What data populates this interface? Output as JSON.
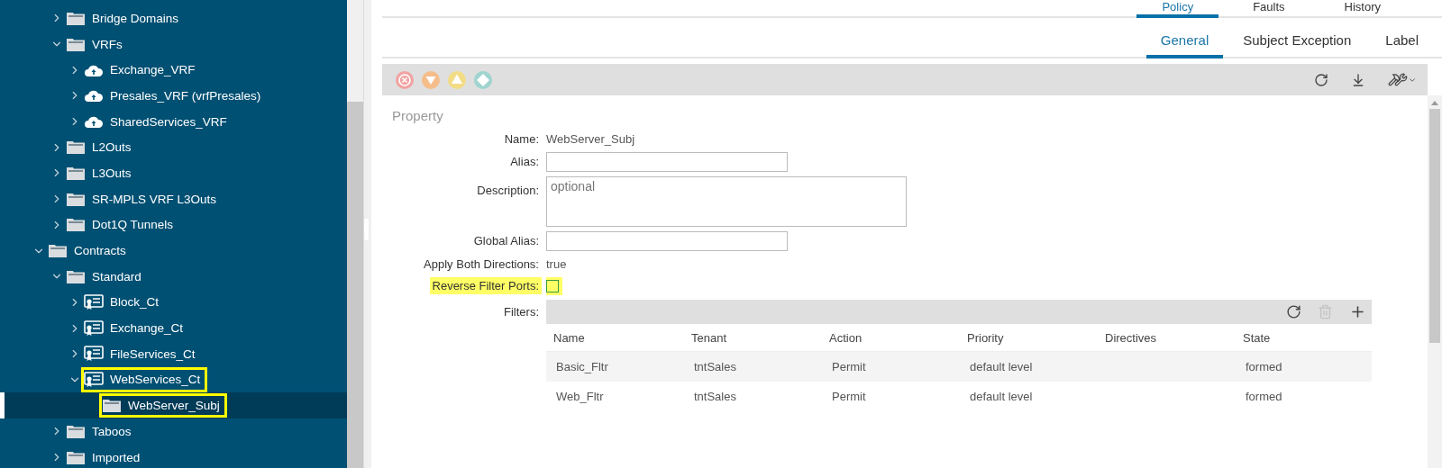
{
  "sidebar": {
    "tree": [
      {
        "children": [
          {
            "label": "Bridge Domains",
            "kind": "folder",
            "expanded": false,
            "selected": false,
            "highlighted": false
          },
          {
            "label": "VRFs",
            "kind": "folder",
            "expanded": true,
            "selected": false,
            "highlighted": false,
            "children": [
              {
                "label": "Exchange_VRF",
                "kind": "vrf",
                "expanded": false,
                "selected": false,
                "highlighted": false
              },
              {
                "label": "Presales_VRF (vrfPresales)",
                "kind": "vrf",
                "expanded": false,
                "selected": false,
                "highlighted": false
              },
              {
                "label": "SharedServices_VRF",
                "kind": "vrf",
                "expanded": false,
                "selected": false,
                "highlighted": false
              }
            ]
          },
          {
            "label": "L2Outs",
            "kind": "folder",
            "expanded": false,
            "selected": false,
            "highlighted": false
          },
          {
            "label": "L3Outs",
            "kind": "folder",
            "expanded": false,
            "selected": false,
            "highlighted": false
          },
          {
            "label": "SR-MPLS VRF L3Outs",
            "kind": "folder",
            "expanded": false,
            "selected": false,
            "highlighted": false
          },
          {
            "label": "Dot1Q Tunnels",
            "kind": "folder",
            "expanded": false,
            "selected": false,
            "highlighted": false
          }
        ]
      },
      {
        "label": "Contracts",
        "kind": "folder",
        "expanded": true,
        "selected": false,
        "highlighted": false,
        "children": [
          {
            "label": "Standard",
            "kind": "folder",
            "expanded": true,
            "selected": false,
            "highlighted": false,
            "children": [
              {
                "label": "Block_Ct",
                "kind": "contract",
                "expanded": false,
                "selected": false,
                "highlighted": false
              },
              {
                "label": "Exchange_Ct",
                "kind": "contract",
                "expanded": false,
                "selected": false,
                "highlighted": false
              },
              {
                "label": "FileServices_Ct",
                "kind": "contract",
                "expanded": false,
                "selected": false,
                "highlighted": false
              },
              {
                "label": "WebServices_Ct",
                "kind": "contract",
                "expanded": true,
                "selected": false,
                "highlighted": true,
                "children": [
                  {
                    "label": "WebServer_Subj",
                    "kind": "folder",
                    "selected": true,
                    "highlighted": true
                  }
                ]
              }
            ]
          },
          {
            "label": "Taboos",
            "kind": "folder",
            "expanded": false,
            "selected": false,
            "highlighted": false
          },
          {
            "label": "Imported",
            "kind": "folder",
            "expanded": false,
            "selected": false,
            "highlighted": false
          }
        ]
      }
    ]
  },
  "top_tabs": [
    {
      "label": "Policy",
      "selected": true
    },
    {
      "label": "Faults",
      "selected": false
    },
    {
      "label": "History",
      "selected": false
    }
  ],
  "sub_tabs": [
    {
      "label": "General",
      "selected": true
    },
    {
      "label": "Subject Exception",
      "selected": false
    },
    {
      "label": "Label",
      "selected": false
    }
  ],
  "property": {
    "heading": "Property",
    "fields": [
      {
        "kind": "text",
        "label": "Name:",
        "value": "WebServer_Subj",
        "highlighted": false
      },
      {
        "kind": "input",
        "label": "Alias:",
        "highlighted": false
      },
      {
        "kind": "textarea",
        "label": "Description:",
        "placeholder": "optional",
        "highlighted": false
      },
      {
        "kind": "input",
        "label": "Global Alias:",
        "highlighted": false
      },
      {
        "kind": "text",
        "label": "Apply Both Directions:",
        "value": "true",
        "highlighted": false
      },
      {
        "kind": "checkbox",
        "label": "Reverse Filter Ports:",
        "checked": false,
        "highlighted": true
      },
      {
        "kind": "table",
        "label": "Filters:",
        "highlighted": false
      }
    ]
  },
  "filters": {
    "toolbar": [
      {
        "kind": "refresh",
        "disabled": false
      },
      {
        "kind": "delete",
        "disabled": true
      },
      {
        "kind": "add",
        "disabled": false
      }
    ],
    "columns": [
      "Name",
      "Tenant",
      "Action",
      "Priority",
      "Directives",
      "State"
    ],
    "rows": [
      [
        "Basic_Fltr",
        "tntSales",
        "Permit",
        "default level",
        "",
        "formed"
      ],
      [
        "Web_Fltr",
        "tntSales",
        "Permit",
        "default level",
        "",
        "formed"
      ]
    ]
  }
}
